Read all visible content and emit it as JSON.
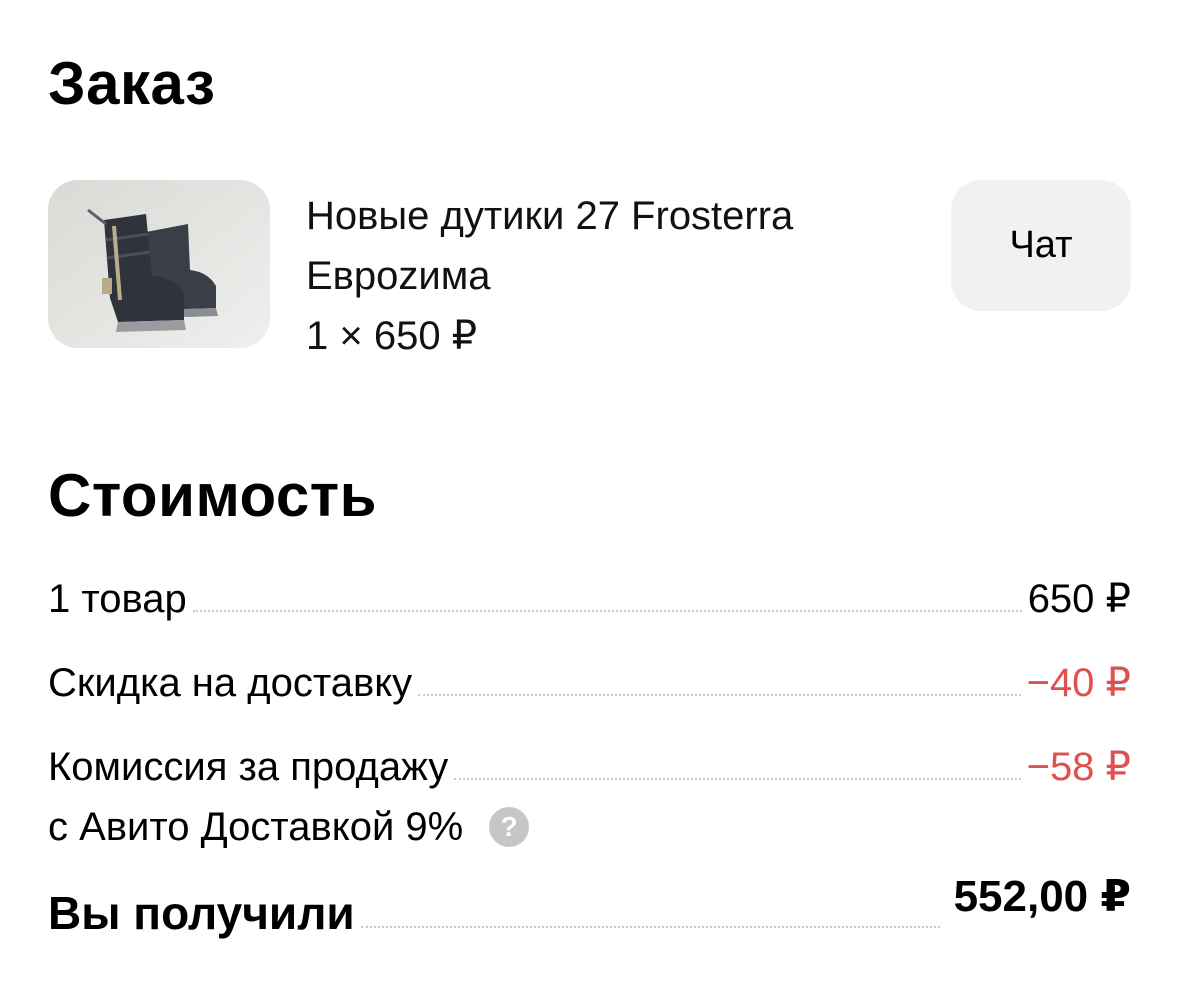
{
  "order": {
    "title": "Заказ",
    "item": {
      "name": "Новые дутики 27 Frosterra Евроzима",
      "quantity_price": "1 × 650 ₽",
      "image_alt": "boots-photo"
    },
    "chat_label": "Чат"
  },
  "cost": {
    "title": "Стоимость",
    "rows": [
      {
        "label": "1 товар",
        "value": "650 ₽"
      },
      {
        "label": "Скидка на доставку",
        "value": "−40 ₽"
      },
      {
        "label": "Комиссия за продажу",
        "label_line2": "с Авито Доставкой 9%",
        "value": "−58 ₽"
      }
    ],
    "total": {
      "label": "Вы получили",
      "value": "552,00 ₽"
    },
    "help_icon": "?"
  },
  "colors": {
    "negative": "#e0504e",
    "chat_bg": "#f2f1f0",
    "help_icon_bg": "#c6c6c6"
  }
}
